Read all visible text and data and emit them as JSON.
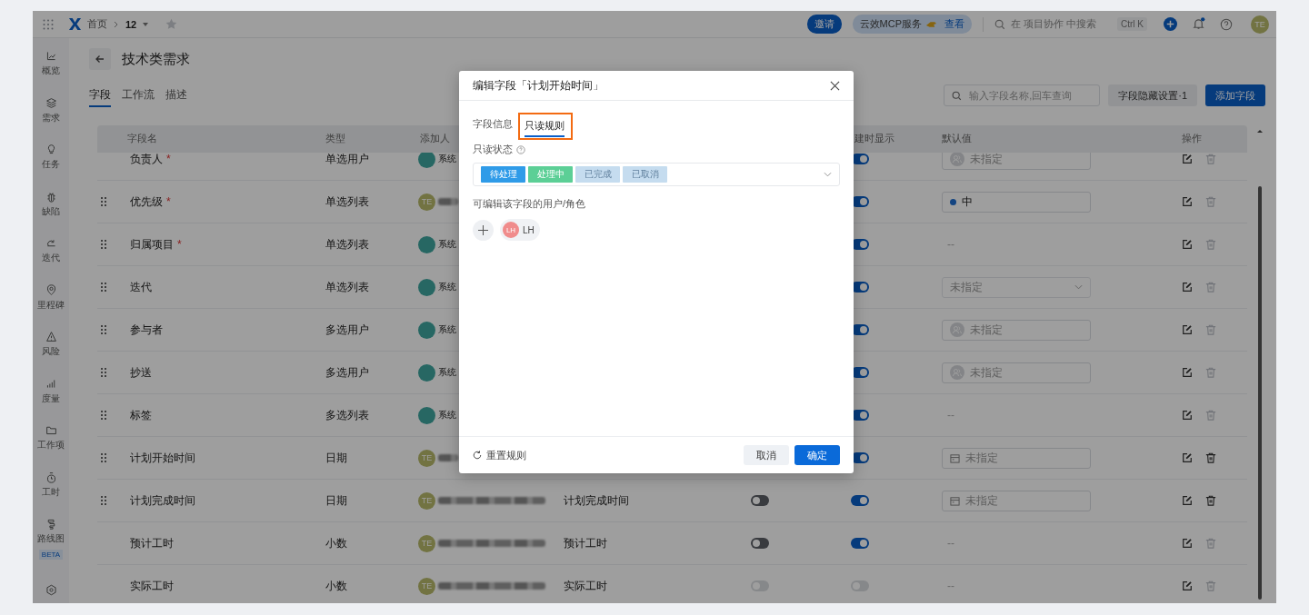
{
  "topbar": {
    "breadcrumb": [
      "首页",
      "12"
    ],
    "invite": "邀请",
    "mcp": {
      "label": "云效MCP服务",
      "link": "查看"
    },
    "search": {
      "placeholder": "在 项目协作 中搜索",
      "shortcut": "Ctrl K"
    },
    "has_unread": true,
    "avatar": "TE"
  },
  "sidebar": {
    "items": [
      {
        "label": "概览"
      },
      {
        "label": "需求"
      },
      {
        "label": "任务"
      },
      {
        "label": "缺陷"
      },
      {
        "label": "迭代"
      },
      {
        "label": "里程碑"
      },
      {
        "label": "风险"
      },
      {
        "label": "度量"
      },
      {
        "label": "工作项"
      },
      {
        "label": "工时"
      },
      {
        "label": "路线图",
        "badge": "BETA"
      }
    ]
  },
  "page": {
    "title": "技术类需求",
    "tabs": [
      {
        "label": "字段",
        "selected": true
      },
      {
        "label": "工作流",
        "selected": false
      },
      {
        "label": "描述",
        "selected": false
      }
    ],
    "field_search": {
      "placeholder": "输入字段名称,回车查询"
    },
    "hidden_fields_button": "字段隐藏设置·1",
    "add_button": "添加字段"
  },
  "table": {
    "columns": {
      "name": "字段名",
      "type": "类型",
      "adder": "添加人",
      "column_7": "建时显示",
      "default": "默认值",
      "actions": "操作"
    },
    "rows": [
      {
        "name": "负责人",
        "required_mark": "*",
        "type": "单选用户",
        "adder": {
          "kind": "system",
          "name": "系统"
        },
        "column_7": {
          "on": true,
          "disabled": false
        },
        "default": {
          "kind": "user",
          "text": "未指定"
        },
        "deletable": false
      },
      {
        "draggable": true,
        "name": "优先级",
        "required_mark": "*",
        "type": "单选列表",
        "adder": {
          "kind": "user",
          "avatar": "TE"
        },
        "column_7": {
          "on": true,
          "disabled": false
        },
        "default": {
          "kind": "select",
          "text": "中"
        },
        "deletable": false
      },
      {
        "draggable": true,
        "name": "归属项目",
        "required_mark": "*",
        "type": "单选列表",
        "adder": {
          "kind": "system",
          "name": "系统"
        },
        "column_7": {
          "on": true,
          "disabled": false
        },
        "default": {
          "kind": "empty",
          "text": "--"
        },
        "deletable": false
      },
      {
        "draggable": true,
        "name": "迭代",
        "type": "单选列表",
        "adder": {
          "kind": "system",
          "name": "系统"
        },
        "column_7": {
          "on": true,
          "disabled": false
        },
        "default": {
          "kind": "dropdown",
          "text": "未指定"
        },
        "deletable": false
      },
      {
        "draggable": true,
        "name": "参与者",
        "type": "多选用户",
        "adder": {
          "kind": "system",
          "name": "系统"
        },
        "column_7": {
          "on": true,
          "disabled": false
        },
        "default": {
          "kind": "user",
          "text": "未指定"
        },
        "deletable": false
      },
      {
        "draggable": true,
        "name": "抄送",
        "type": "多选用户",
        "adder": {
          "kind": "system",
          "name": "系统"
        },
        "column_7": {
          "on": true,
          "disabled": false
        },
        "default": {
          "kind": "user",
          "text": "未指定"
        },
        "deletable": false
      },
      {
        "draggable": true,
        "name": "标签",
        "type": "多选列表",
        "adder": {
          "kind": "system",
          "name": "系统"
        },
        "column_7": {
          "on": true,
          "disabled": false
        },
        "default": {
          "kind": "empty",
          "text": "--"
        },
        "deletable": false
      },
      {
        "draggable": true,
        "name": "计划开始时间",
        "type": "日期",
        "adder": {
          "kind": "user",
          "avatar": "TE"
        },
        "column_7": {
          "on": true,
          "disabled": false
        },
        "default": {
          "kind": "date",
          "text": "未指定"
        },
        "deletable": true
      },
      {
        "draggable": true,
        "name": "计划完成时间",
        "type": "日期",
        "adder": {
          "kind": "user",
          "avatar": "TE"
        },
        "column_5": "计划完成时间",
        "column_6": {
          "on": false,
          "disabled": false
        },
        "column_7": {
          "on": true,
          "disabled": false
        },
        "default": {
          "kind": "date",
          "text": "未指定"
        },
        "deletable": true
      },
      {
        "name": "预计工时",
        "type": "小数",
        "adder": {
          "kind": "user",
          "avatar": "TE"
        },
        "column_5": "预计工时",
        "column_6": {
          "on": false,
          "disabled": false
        },
        "column_7": {
          "on": true,
          "disabled": false
        },
        "default": {
          "kind": "empty",
          "text": "--"
        },
        "deletable": false
      },
      {
        "name": "实际工时",
        "type": "小数",
        "adder": {
          "kind": "user",
          "avatar": "TE"
        },
        "column_5": "实际工时",
        "column_6": {
          "on": false,
          "disabled": true
        },
        "column_7": {
          "on": false,
          "disabled": true
        },
        "default": {
          "kind": "empty",
          "text": "--"
        },
        "deletable": false
      }
    ]
  },
  "modal": {
    "title": "编辑字段「计划开始时间」",
    "tabs": [
      {
        "label": "字段信息",
        "selected": false,
        "highlighted": false
      },
      {
        "label": "只读规则",
        "selected": true,
        "highlighted": true
      }
    ],
    "readonly_label": "只读状态",
    "status_tags": [
      {
        "label": "待处理",
        "selected": true,
        "color": "#2f9be8"
      },
      {
        "label": "处理中",
        "selected": true,
        "color": "#5ccf96"
      },
      {
        "label": "已完成",
        "selected": false,
        "color": "#c5dcef"
      },
      {
        "label": "已取消",
        "selected": false,
        "color": "#c5dcef"
      }
    ],
    "editors_label": "可编辑该字段的用户/角色",
    "editors": [
      {
        "avatar": "LH",
        "name": "LH",
        "color": "#f08c8c"
      }
    ],
    "reset": "重置规则",
    "cancel": "取消",
    "confirm": "确定"
  }
}
